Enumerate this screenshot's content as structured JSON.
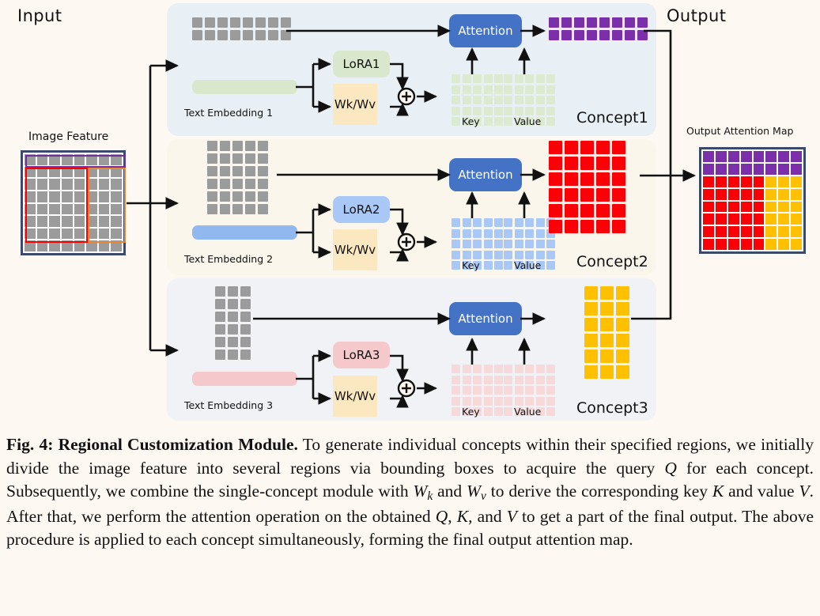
{
  "figure": {
    "input_label": "Input",
    "output_label": "Output",
    "image_feature_label": "Image Feature",
    "output_attention_map_label": "Output Attention Map",
    "key_label": "Key",
    "value_label": "Value",
    "attention_label": "Attention",
    "wkwv_label_line1": "Wk/",
    "wkwv_label_line2": "Wv"
  },
  "colors": {
    "page_background": "#fdf9f2",
    "panel1_background": "#e8f0f5",
    "panel2_background": "#faf6ec",
    "panel3_background": "#f0f2f5",
    "attention_blue": "#4472c4",
    "wkwv_cream": "#fce8c0",
    "gray_cell": "#9b9b9b",
    "grid_border": "#3b4a6b",
    "concept1_accent": "#7b2fa8",
    "concept2_accent": "#fb0007",
    "concept3_accent": "#ffc000",
    "bbox_purple": "#7030a0",
    "bbox_red": "#ff0000",
    "bbox_orange": "#e8873a",
    "lora1_fill": "#d9e8cc",
    "lora2_fill": "#aac8f5",
    "lora3_fill": "#f5c9cb",
    "emb1_fill": "#d9e8cc",
    "emb2_fill": "#92b8f0",
    "emb3_fill": "#f5c9cb",
    "kv1_fill": "#dcead0",
    "kv2_fill": "#aac8f5",
    "kv3_fill": "#f7d9da"
  },
  "image_feature": {
    "rows": 8,
    "cols": 8,
    "cell_color": "#9b9b9b",
    "bounding_boxes": [
      {
        "name": "concept1-region",
        "color": "#7030a0",
        "col_start": 0,
        "col_span": 8,
        "row_start": 0,
        "row_span": 1
      },
      {
        "name": "concept2-region",
        "color": "#ff0000",
        "col_start": 0,
        "col_span": 5,
        "row_start": 1,
        "row_span": 6
      },
      {
        "name": "concept3-region",
        "color": "#e8873a",
        "col_start": 5,
        "col_span": 3,
        "row_start": 1,
        "row_span": 6
      }
    ]
  },
  "output_attention_map": {
    "rows": 8,
    "cols": 8,
    "regions": [
      {
        "name": "concept1-purple-band",
        "color": "#7b2fa8",
        "rows": "1-2",
        "cols": "1-8"
      },
      {
        "name": "concept2-red-block",
        "color": "#fb0007",
        "rows": "3-8",
        "cols": "1-5"
      },
      {
        "name": "concept3-yellow-block",
        "color": "#ffc000",
        "rows": "3-8",
        "cols": "6-8"
      }
    ]
  },
  "concepts": [
    {
      "id": "concept1",
      "title": "Concept1",
      "lora_label": "LoRA1",
      "text_embedding_label": "Text Embedding 1",
      "query_grid": {
        "cols": 8,
        "rows": 2,
        "color": "#9b9b9b"
      },
      "key_grid": {
        "cols": 5,
        "rows": 5,
        "color": "#dcead0"
      },
      "value_grid": {
        "cols": 5,
        "rows": 5,
        "color": "#dcead0"
      },
      "output_grid": {
        "cols": 8,
        "rows": 2,
        "color": "#7b2fa8"
      },
      "panel_background": "#e8f0f5",
      "lora_fill": "#d9e8cc",
      "embedding_fill": "#d9e8cc"
    },
    {
      "id": "concept2",
      "title": "Concept2",
      "lora_label": "LoRA2",
      "text_embedding_label": "Text Embedding 2",
      "query_grid": {
        "cols": 5,
        "rows": 6,
        "color": "#9b9b9b"
      },
      "key_grid": {
        "cols": 5,
        "rows": 5,
        "color": "#aac8f5"
      },
      "value_grid": {
        "cols": 5,
        "rows": 5,
        "color": "#aac8f5"
      },
      "output_grid": {
        "cols": 5,
        "rows": 6,
        "color": "#fb0007"
      },
      "panel_background": "#faf6ec",
      "lora_fill": "#aac8f5",
      "embedding_fill": "#92b8f0"
    },
    {
      "id": "concept3",
      "title": "Concept3",
      "lora_label": "LoRA3",
      "text_embedding_label": "Text Embedding 3",
      "query_grid": {
        "cols": 3,
        "rows": 6,
        "color": "#9b9b9b"
      },
      "key_grid": {
        "cols": 5,
        "rows": 5,
        "color": "#f7d9da"
      },
      "value_grid": {
        "cols": 5,
        "rows": 5,
        "color": "#f7d9da"
      },
      "output_grid": {
        "cols": 3,
        "rows": 6,
        "color": "#ffc000"
      },
      "panel_background": "#f0f2f5",
      "lora_fill": "#f5c9cb",
      "embedding_fill": "#f5c9cb"
    }
  ],
  "caption": {
    "figure_number": "Fig. 4:",
    "title": "Regional Customization Module.",
    "body_part1": " To generate individual concepts within their specified regions, we initially divide the image feature into several regions via bounding boxes to acquire the query ",
    "math_q1": "Q",
    "body_part2": " for each concept. Subsequently, we combine the single-concept module with ",
    "math_wk": "W",
    "math_wk_sub": "k",
    "body_part3": " and ",
    "math_wv": "W",
    "math_wv_sub": "v",
    "body_part4": " to derive the corresponding key ",
    "math_k1": "K",
    "body_part5": " and value ",
    "math_v1": "V",
    "body_part6": ". After that, we perform the attention operation on the obtained ",
    "math_q2": "Q",
    "body_part7": ", ",
    "math_k2": "K",
    "body_part8": ", and ",
    "math_v2": "V",
    "body_part9": " to get a part of the final output. The above procedure is applied to each concept simultaneously, forming the final output attention map."
  }
}
